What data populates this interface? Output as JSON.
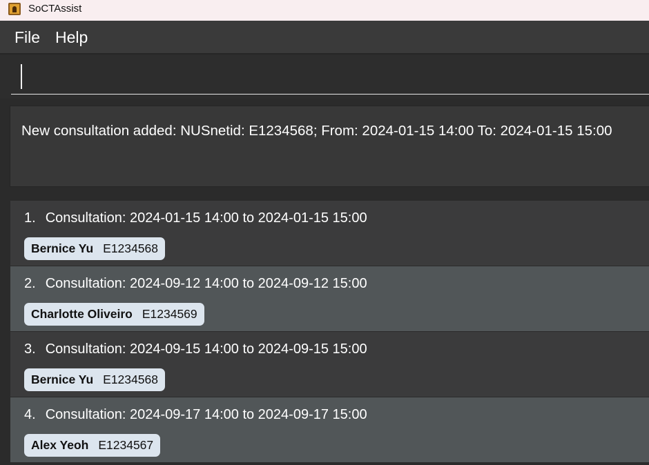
{
  "window": {
    "title": "SoCTAssist"
  },
  "menu": {
    "file": "File",
    "help": "Help"
  },
  "command": {
    "value": "",
    "placeholder": ""
  },
  "result": {
    "message": "New consultation added: NUSnetid: E1234568; From: 2024-01-15 14:00 To: 2024-01-15 15:00"
  },
  "consultations": [
    {
      "index": "1.",
      "label": "Consultation: 2024-01-15 14:00 to 2024-01-15 15:00",
      "student_name": "Bernice Yu",
      "student_id": "E1234568"
    },
    {
      "index": "2.",
      "label": "Consultation: 2024-09-12 14:00 to 2024-09-12 15:00",
      "student_name": "Charlotte Oliveiro",
      "student_id": "E1234569"
    },
    {
      "index": "3.",
      "label": "Consultation: 2024-09-15 14:00 to 2024-09-15 15:00",
      "student_name": "Bernice Yu",
      "student_id": "E1234568"
    },
    {
      "index": "4.",
      "label": "Consultation: 2024-09-17 14:00 to 2024-09-17 15:00",
      "student_name": "Alex Yeoh",
      "student_id": "E1234567"
    }
  ],
  "colors": {
    "titlebar_bg": "#f9eef0",
    "menubar_bg": "#3a3a3a",
    "card_dark": "#3b3b3c",
    "card_light": "#515658",
    "tag_bg": "#dce5ee"
  }
}
